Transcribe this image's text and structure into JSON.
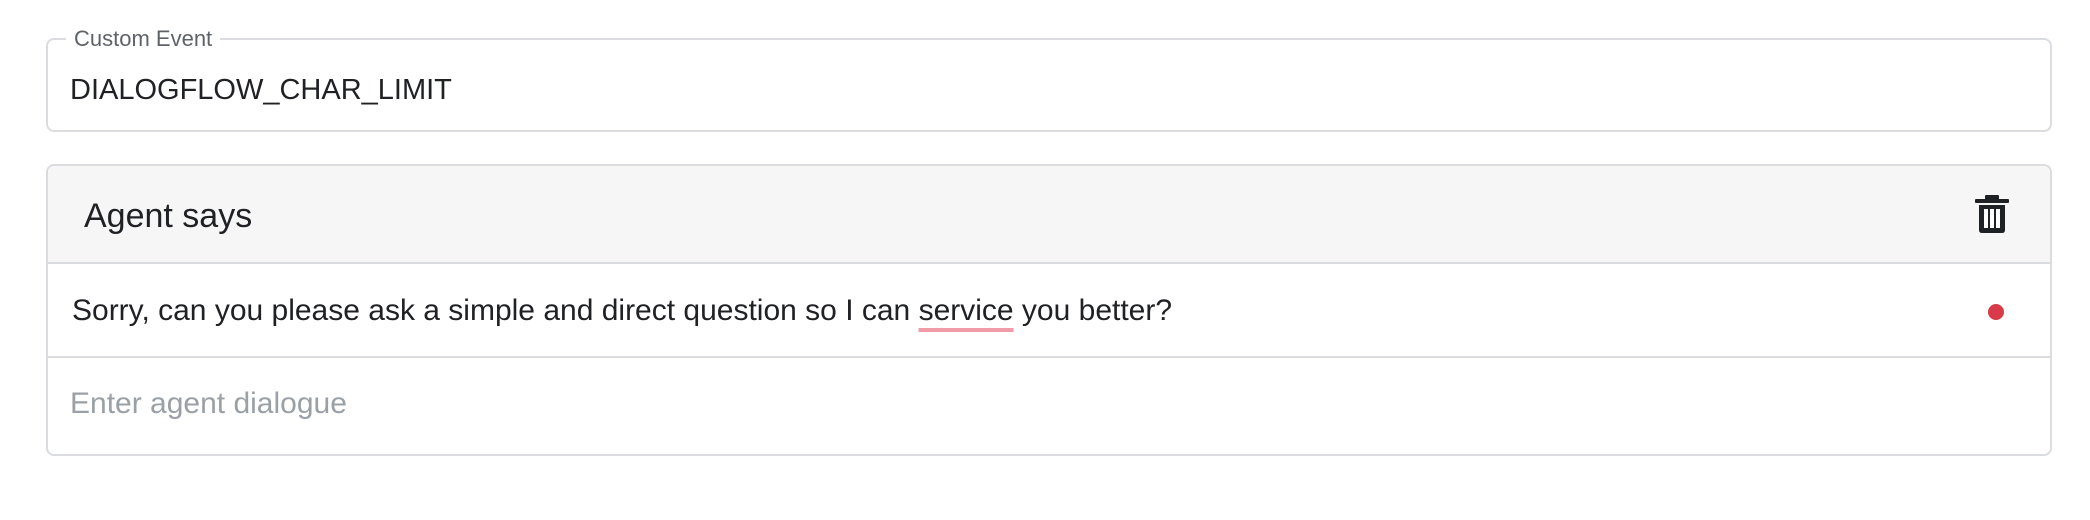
{
  "custom_event": {
    "label": "Custom Event",
    "value": "DIALOGFLOW_CHAR_LIMIT"
  },
  "agent_says": {
    "title": "Agent says",
    "delete_icon": "trash-icon",
    "response": {
      "before": "Sorry, can you please ask a simple and direct question so I can ",
      "misspelled": "service",
      "after": " you better?"
    },
    "status_color": "#d93a4a",
    "input": {
      "placeholder": "Enter agent dialogue",
      "value": ""
    }
  }
}
